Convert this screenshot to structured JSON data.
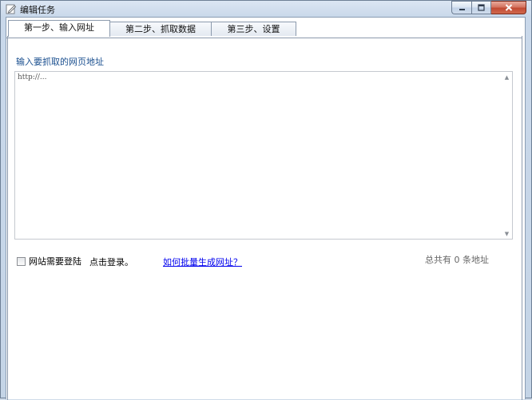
{
  "window": {
    "title": "编辑任务",
    "icon": "edit-pencil-icon"
  },
  "tabs": [
    {
      "label": "第一步、输入网址",
      "active": true
    },
    {
      "label": "第二步、抓取数据",
      "active": false
    },
    {
      "label": "第三步、设置",
      "active": false
    }
  ],
  "step1": {
    "section_label": "输入要抓取的网页地址",
    "url_text": "http://...",
    "login_checkbox_label": "网站需要登陆",
    "login_hint": "点击登录。",
    "batch_help_link": "如何批量生成网址？",
    "count_summary": "总共有 0 条地址"
  },
  "colors": {
    "accent_label": "#1a4f8f",
    "link": "#0000ee",
    "close_button": "#c24a33"
  }
}
